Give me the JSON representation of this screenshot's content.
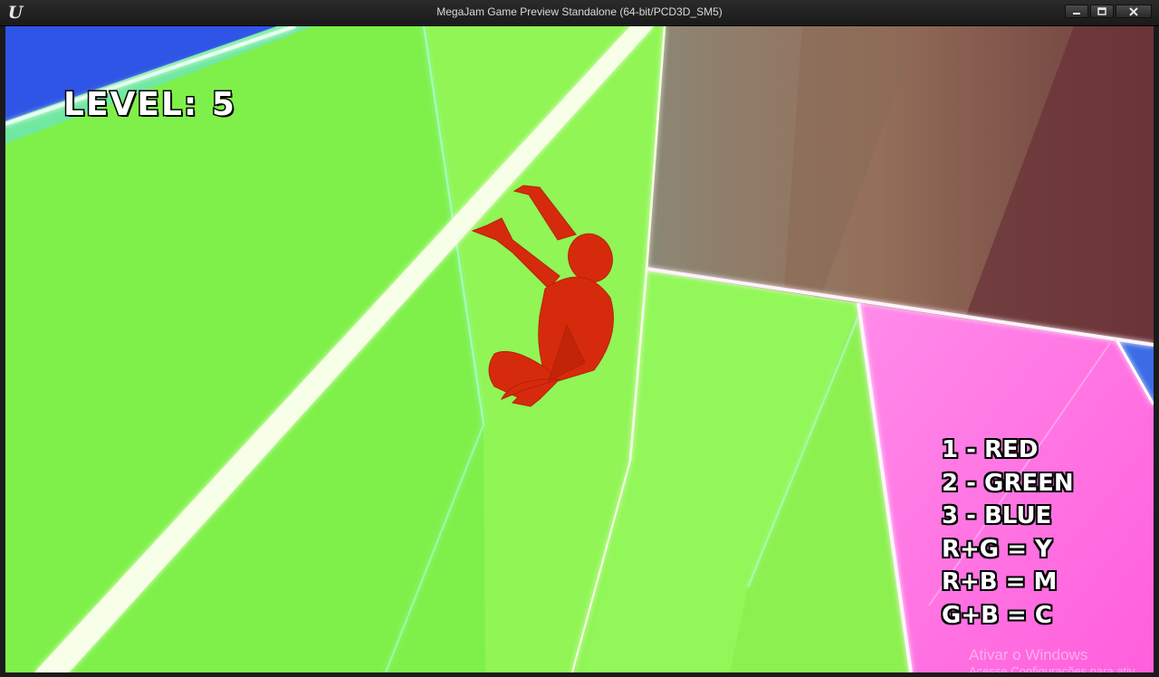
{
  "window": {
    "title": "MegaJam Game Preview Standalone (64-bit/PCD3D_SM5)",
    "app_icon": "unreal-engine-logo-icon",
    "controls": [
      "minimize-icon",
      "maximize-icon",
      "close-icon"
    ]
  },
  "hud": {
    "level_text": "LEVEL: 5",
    "legend": [
      "1 - RED",
      "2 - GREEN",
      "3 - BLUE",
      "R+G = Y",
      "R+B = M",
      "G+B = C"
    ]
  },
  "watermark": {
    "line1": "Ativar o Windows",
    "line2": "Acesse Configurações para ativ"
  },
  "colors": {
    "wall_green": "#8ef551",
    "wall_blue": "#2f55e6",
    "wall_magenta": "#ff7fe6",
    "character_red": "#d42a0a",
    "glow_white": "#f6ffe6"
  }
}
